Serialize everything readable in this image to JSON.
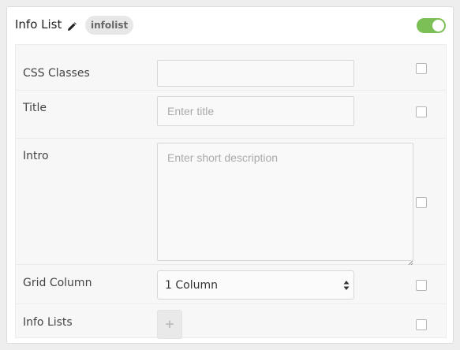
{
  "header": {
    "title": "Info List",
    "edit_icon": "pencil-icon",
    "badge": "infolist",
    "toggle_state": "on",
    "toggle_color": "#7cbf57"
  },
  "fields": {
    "css_classes": {
      "label": "CSS Classes",
      "value": "",
      "placeholder": ""
    },
    "title": {
      "label": "Title",
      "value": "",
      "placeholder": "Enter title"
    },
    "intro": {
      "label": "Intro",
      "value": "",
      "placeholder": "Enter short description"
    },
    "grid_column": {
      "label": "Grid Column",
      "selected": "1 Column",
      "icon": "updown-arrows-icon"
    },
    "info_lists": {
      "label": "Info Lists",
      "add_label": "+"
    }
  }
}
